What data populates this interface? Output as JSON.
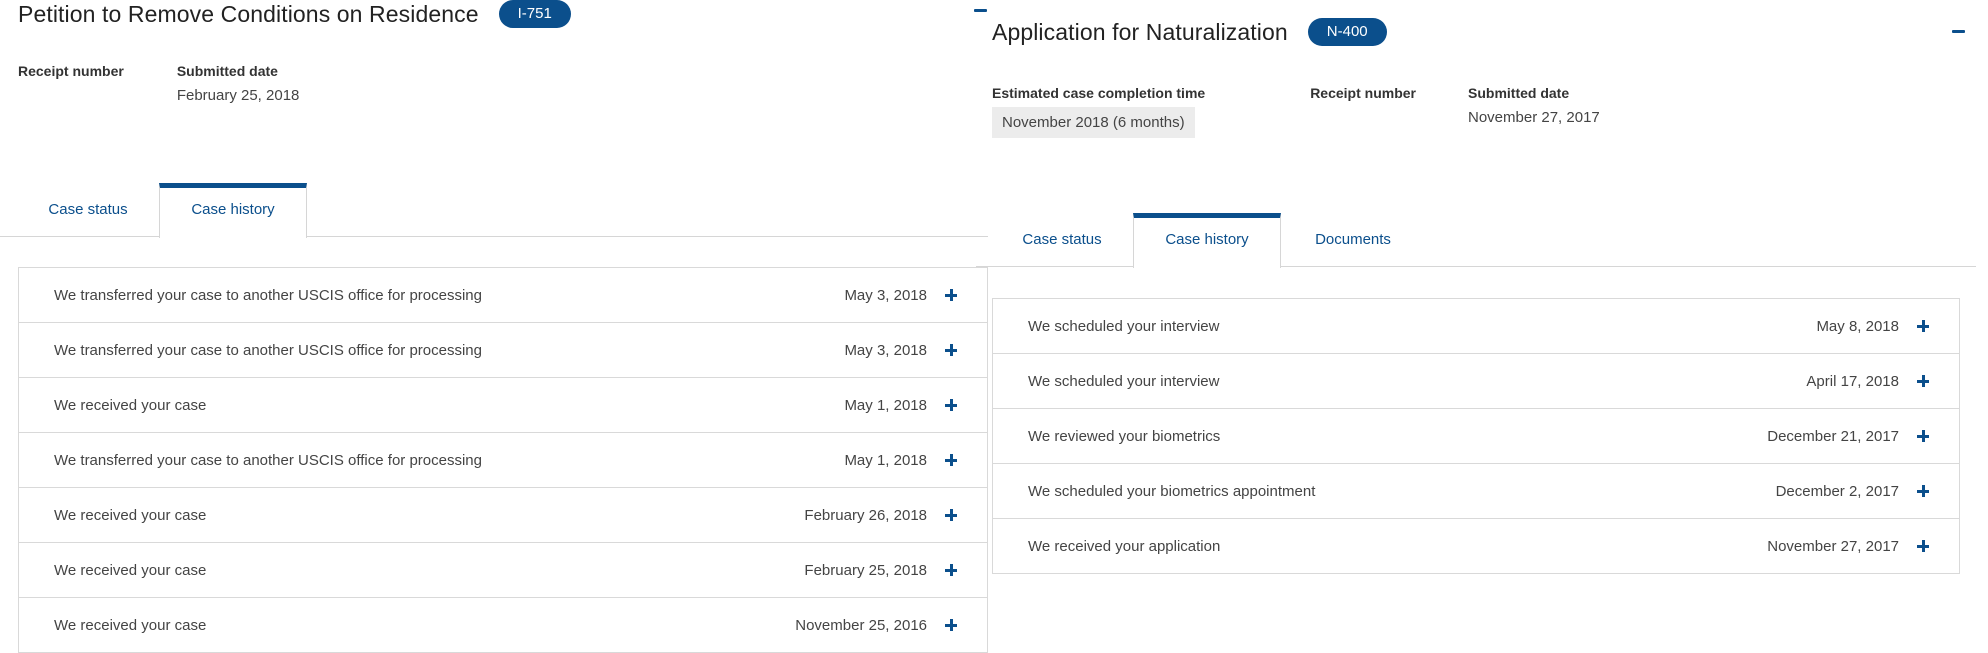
{
  "left": {
    "title": "Petition to Remove Conditions on Residence",
    "form_badge": "I-751",
    "meta": {
      "receipt_label": "Receipt number",
      "submitted_label": "Submitted date",
      "submitted_value": "February 25, 2018"
    },
    "tabs": [
      {
        "label": "Case status",
        "active": false
      },
      {
        "label": "Case history",
        "active": true
      }
    ],
    "history": [
      {
        "description": "We transferred your case to another USCIS office for processing",
        "date": "May 3, 2018"
      },
      {
        "description": "We transferred your case to another USCIS office for processing",
        "date": "May 3, 2018"
      },
      {
        "description": "We received your case",
        "date": "May 1, 2018"
      },
      {
        "description": "We transferred your case to another USCIS office for processing",
        "date": "May 1, 2018"
      },
      {
        "description": "We received your case",
        "date": "February 26, 2018"
      },
      {
        "description": "We received your case",
        "date": "February 25, 2018"
      },
      {
        "description": "We received your case",
        "date": "November 25, 2016"
      }
    ]
  },
  "right": {
    "title": "Application for Naturalization",
    "form_badge": "N-400",
    "meta": {
      "estimate_label": "Estimated case completion time",
      "estimate_value": "November 2018 (6 months)",
      "receipt_label": "Receipt number",
      "submitted_label": "Submitted date",
      "submitted_value": "November 27, 2017"
    },
    "tabs": [
      {
        "label": "Case status",
        "active": false
      },
      {
        "label": "Case history",
        "active": true
      },
      {
        "label": "Documents",
        "active": false
      }
    ],
    "history": [
      {
        "description": "We scheduled your interview",
        "date": "May 8, 2018"
      },
      {
        "description": "We scheduled your interview",
        "date": "April 17, 2018"
      },
      {
        "description": "We reviewed your biometrics",
        "date": "December 21, 2017"
      },
      {
        "description": "We scheduled your biometrics appointment",
        "date": "December 2, 2017"
      },
      {
        "description": "We received your application",
        "date": "November 27, 2017"
      }
    ]
  },
  "icons": {
    "collapse": "minus-icon",
    "expand": "plus-icon"
  },
  "colors": {
    "accent": "#0b4f8c",
    "border": "#d9d9d9",
    "estimate_bg": "#ececec"
  }
}
